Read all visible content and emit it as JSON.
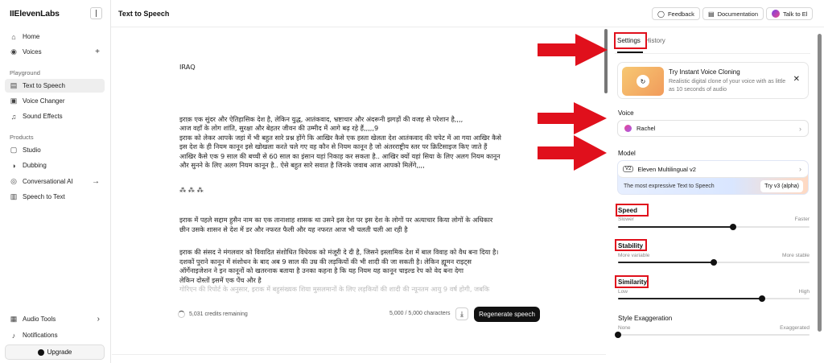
{
  "sidebar": {
    "brand": "IIElevenLabs",
    "top_items": [
      {
        "label": "Home",
        "icon": "home-icon"
      },
      {
        "label": "Voices",
        "icon": "voices-icon"
      }
    ],
    "playground_label": "Playground",
    "playground_items": [
      {
        "label": "Text to Speech",
        "icon": "tts-icon",
        "active": true
      },
      {
        "label": "Voice Changer",
        "icon": "voice-changer-icon"
      },
      {
        "label": "Sound Effects",
        "icon": "sound-effects-icon"
      }
    ],
    "products_label": "Products",
    "product_items": [
      {
        "label": "Studio",
        "icon": "studio-icon"
      },
      {
        "label": "Dubbing",
        "icon": "dubbing-icon"
      },
      {
        "label": "Conversational AI",
        "icon": "conversational-ai-icon"
      },
      {
        "label": "Speech to Text",
        "icon": "speech-to-text-icon"
      }
    ],
    "bottom_items": [
      {
        "label": "Audio Tools",
        "icon": "audio-tools-icon"
      },
      {
        "label": "Notifications",
        "icon": "bell-icon"
      }
    ],
    "upgrade_label": "Upgrade"
  },
  "header": {
    "title": "Text to Speech",
    "feedback": "Feedback",
    "documentation": "Documentation",
    "talk": "Talk to El"
  },
  "editor": {
    "heading": "IRAQ",
    "para1": [
      "इराक़ एक सुंदर और ऐतिहासिक देश है, लेकिन युद्ध, आतंकवाद, भ्रष्टाचार और अंदरूनी झगड़ों की वजह से परेशान है,,,,",
      "आज वहाँ के लोग शांति, सुरक्षा और बेहतर जीवन की उम्मीद में आगे बढ़ रहे हैं,,,,,9",
      "इराक को लेकर आपके जहां में भी बहुत सारे प्रश्न होंगे कि आखिर कैसे एक हस्ता खेलता देश आतंकवाद की चपेट में आ गया आखिर कैसे",
      "इस देश के ही नियम कानून इसे खोखला करते चले गए वह कौन से नियम कानून है जो अंतरराष्ट्रीय स्तर पर क्रिटिसाइज किए जाते हैं",
      "आखिर कैसे एक 9 साल की बच्ची से 60 साल का इंसान यहां निकाह कर सकता है.. आखिर क्यों यहां सिया के लिए अलग नियम कानून",
      "और सुनने के लिए अलग नियम कानून है.. ऐसे बहुत सारे सवात है जिनके जवाब आज आपको मिलेंगे,,,,"
    ],
    "separator": "⁂ ⁂ ⁂",
    "para2": [
      "इराक में पहले सद्दाम हुसैन नाम का एक तानाशाह शासक था उसने इस देश पर इस देश के लोगों पर अत्याचार किया लोगों के अधिकार",
      "छीन उसके शासन से देश में डर और नफरत फैली और यह नफरत आज भी चलती चली आ रही है"
    ],
    "para3": [
      "इराक की संसद ने मंगलवार को विवादित संशोधित विधेयक को मंजूरी दे दी है, जिसने इस्लामिक देश में बाल विवाह को वैध बना दिया है।",
      "दशकों पुराने कानून में संशोधन के बाद अब 9 साल की उम्र की लड़कियों की भी शादी की जा सकती है। लेकिन ह्यूमन राइट्स",
      "ऑर्गेनाइजेशन ने इन कानूनों को खतरनाक बताया है उनका कहना है कि यह नियम यह कानून चाइल्ड रेप को वेद बना देगा",
      "लेकिन दोस्तों इसमें एक पेंच और है",
      "गोरिएन की रिपोर्ट के अनुसार, इराक में बहुसंख्यक शिया मुसलमानों के लिए लड़कियों की शादी की न्यूनतम आयु 9 वर्ष होगी, जबकि"
    ]
  },
  "footer": {
    "credits": "5,031 credits remaining",
    "chars": "5,000 / 5,000 characters",
    "regenerate": "Regenerate speech"
  },
  "panel": {
    "tabs": [
      {
        "label": "Settings",
        "active": true
      },
      {
        "label": "History",
        "active": false
      }
    ],
    "promo": {
      "title": "Try Instant Voice Cloning",
      "desc": "Realistic digital clone of your voice with as little as 10 seconds of audio"
    },
    "voice_label": "Voice",
    "voice_value": "Rachel",
    "model_label": "Model",
    "model_badge": "V2",
    "model_value": "Eleven Multilingual v2",
    "model_tagline": "The most expressive Text to Speech",
    "model_try": "Try v3 (alpha)",
    "speed": {
      "label": "Speed",
      "min": "Slower",
      "max": "Faster",
      "value": 0.6
    },
    "stability": {
      "label": "Stability",
      "min": "More variable",
      "max": "More stable",
      "value": 0.5
    },
    "similarity": {
      "label": "Similarity",
      "min": "Low",
      "max": "High",
      "value": 0.75
    },
    "style": {
      "label": "Style Exaggeration",
      "min": "None",
      "max": "Exaggerated",
      "value": 0.0
    }
  },
  "colors": {
    "annotation_red": "#e0101c",
    "primary_dark": "#111111"
  }
}
